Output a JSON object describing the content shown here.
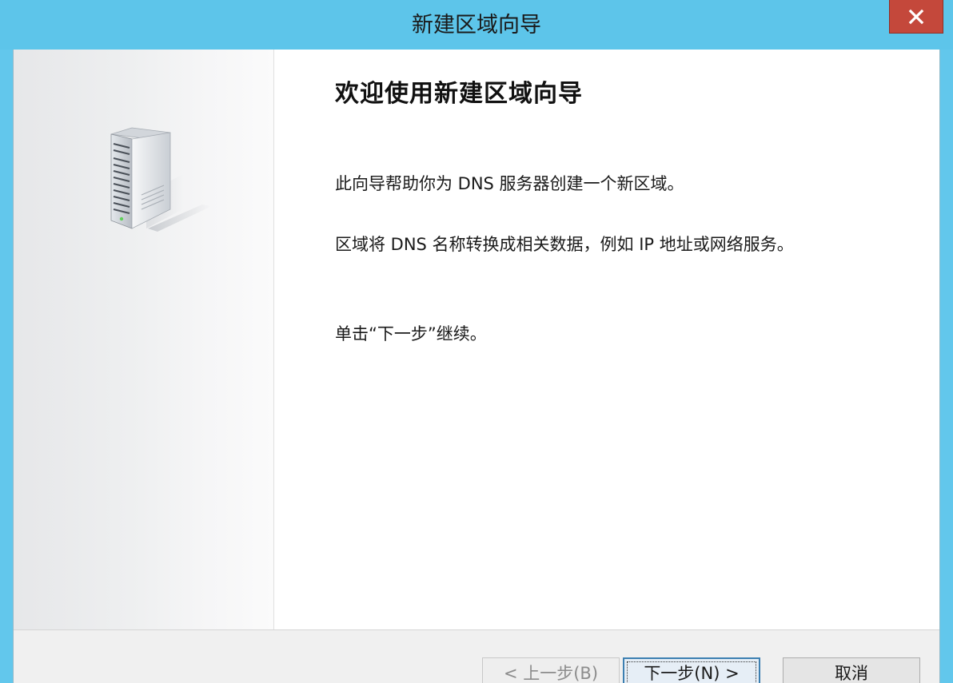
{
  "window": {
    "title": "新建区域向导"
  },
  "icons": {
    "close": "close-icon",
    "illustration": "server-icon"
  },
  "colors": {
    "titlebar": "#5dc5ea",
    "close_button": "#c4483b"
  },
  "main": {
    "heading": "欢迎使用新建区域向导",
    "paragraph1": "此向导帮助你为 DNS 服务器创建一个新区域。",
    "paragraph2": "区域将 DNS 名称转换成相关数据，例如 IP 地址或网络服务。",
    "paragraph3": "单击“下一步”继续。"
  },
  "buttons": {
    "back_label": "< 上一步(B)",
    "next_label": "下一步(N) >",
    "cancel_label": "取消"
  }
}
